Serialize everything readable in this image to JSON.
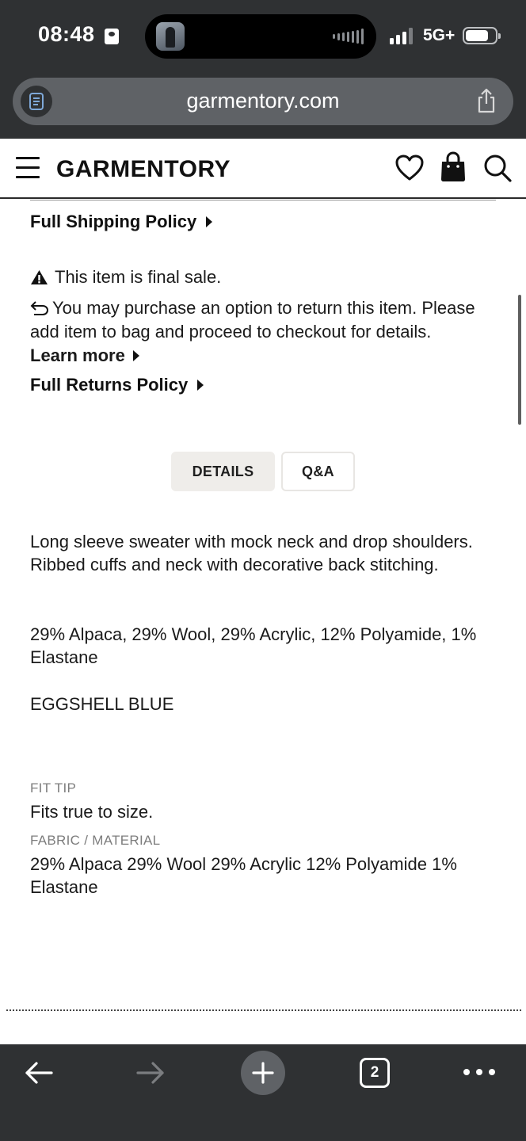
{
  "status_bar": {
    "time": "08:48",
    "network": "5G+"
  },
  "browser": {
    "url": "garmentory.com",
    "tab_count": "2"
  },
  "header": {
    "brand": "GARMENTORY"
  },
  "policies": {
    "shipping_link": "Full Shipping Policy",
    "final_sale": "This item is final sale.",
    "return_option": "You may purchase an option to return this item. Please add item to bag and proceed to checkout for details.",
    "learn_more": "Learn more",
    "returns_link": "Full Returns Policy"
  },
  "tabs": {
    "details": "DETAILS",
    "qa": "Q&A"
  },
  "details": {
    "description": "Long sleeve sweater with mock neck and drop shoulders. Ribbed cuffs and neck with decorative back stitching.",
    "composition": "29% Alpaca, 29% Wool, 29% Acrylic, 12% Polyamide, 1% Elastane",
    "color": "EGGSHELL BLUE",
    "fit_tip_label": "FIT TIP",
    "fit_tip": "Fits true to size.",
    "fabric_label": "FABRIC / MATERIAL",
    "fabric": "29% Alpaca 29% Wool 29% Acrylic 12% Polyamide 1% Elastane"
  },
  "icons": {
    "header": [
      "menu-icon",
      "heart-icon",
      "bag-icon",
      "search-icon"
    ],
    "toolbar": [
      "back-arrow-icon",
      "forward-arrow-icon",
      "plus-icon",
      "tabs-icon",
      "more-icon"
    ]
  },
  "colors": {
    "chrome_bg": "#2f3133",
    "url_bar_bg": "#5f6266",
    "active_tab_bg": "#efedea",
    "text_primary": "#1a1a1a",
    "text_muted": "#7d7d7d"
  }
}
